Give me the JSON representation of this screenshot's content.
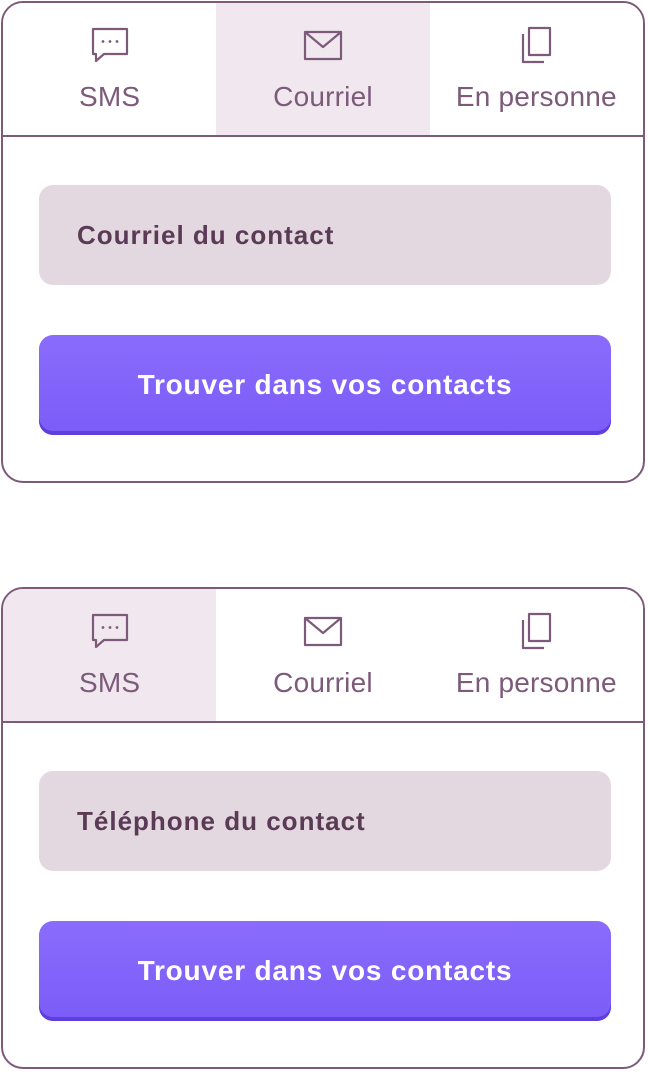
{
  "panels": [
    {
      "tabs": [
        {
          "label": "SMS",
          "icon": "chat-bubble-icon",
          "active": false
        },
        {
          "label": "Courriel",
          "icon": "mail-icon",
          "active": true
        },
        {
          "label": "En personne",
          "icon": "copy-icon",
          "active": false
        }
      ],
      "field_label": "Courriel du contact",
      "button_label": "Trouver dans vos contacts"
    },
    {
      "tabs": [
        {
          "label": "SMS",
          "icon": "chat-bubble-icon",
          "active": true
        },
        {
          "label": "Courriel",
          "icon": "mail-icon",
          "active": false
        },
        {
          "label": "En personne",
          "icon": "copy-icon",
          "active": false
        }
      ],
      "field_label": "Téléphone du contact",
      "button_label": "Trouver dans vos contacts"
    }
  ],
  "colors": {
    "border": "#7d5a7a",
    "tab_text": "#7d5a7a",
    "active_tab_bg": "#f0e8ee",
    "field_bg": "#e3d8e0",
    "field_text": "#5a3a55",
    "button_bg": "#7b5cf7",
    "button_text": "#ffffff"
  }
}
